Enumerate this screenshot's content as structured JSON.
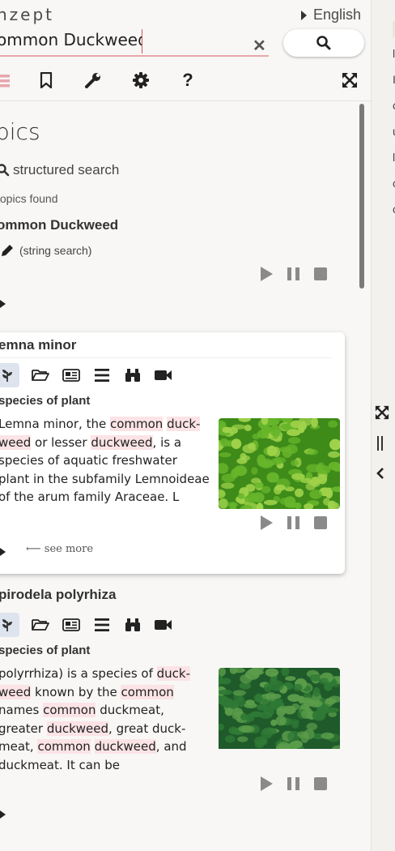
{
  "header": {
    "brand": "nzept",
    "language": "English",
    "search_value": "ommon Duckweed",
    "clear_symbol": "✕"
  },
  "toolbar": {
    "icons": [
      "menu-icon",
      "bookmark-icon",
      "wrench-icon",
      "gear-icon",
      "help-icon",
      "expand-icon"
    ],
    "help_glyph": "?"
  },
  "content": {
    "title": "pics",
    "structured_search": "structured search",
    "found_text": "topics found",
    "query_echo": "ommon Duckweed",
    "string_search": "(string search)"
  },
  "cards": [
    {
      "title": "emna minor",
      "description": "species of plant",
      "see_more": "see more",
      "text_parts": [
        {
          "t": "Lemna minor, the ",
          "h": false
        },
        {
          "t": "common",
          "h": true
        },
        {
          "t": " ",
          "h": false
        },
        {
          "t": "duck-",
          "h": true
        },
        {
          "t": "\n",
          "h": false
        },
        {
          "t": "weed",
          "h": true
        },
        {
          "t": " or lesser ",
          "h": false
        },
        {
          "t": "duckweed",
          "h": true
        },
        {
          "t": ", is a\nspecies of aquatic freshwater\nplant in the subfamily Lemnoideae\nof the arum family Araceae. L",
          "h": false
        }
      ],
      "image_colors": [
        "#3e8b1a",
        "#67b52a",
        "#9fd24a"
      ]
    },
    {
      "title": "pirodela polyrhiza",
      "description": "species of plant",
      "text_parts": [
        {
          "t": "polyrrhiza) is a species of ",
          "h": false
        },
        {
          "t": "duck-",
          "h": true
        },
        {
          "t": "\n",
          "h": false
        },
        {
          "t": "weed",
          "h": true
        },
        {
          "t": " known by the ",
          "h": false
        },
        {
          "t": "common",
          "h": true
        },
        {
          "t": "\nnames ",
          "h": false
        },
        {
          "t": "common",
          "h": true
        },
        {
          "t": " duckmeat,\ngreater ",
          "h": false
        },
        {
          "t": "duckweed",
          "h": true
        },
        {
          "t": ", great duck-\nmeat, ",
          "h": false
        },
        {
          "t": "common",
          "h": true
        },
        {
          "t": " ",
          "h": false
        },
        {
          "t": "duckweed",
          "h": true
        },
        {
          "t": ", and\nduckmeat. It can be",
          "h": false
        }
      ],
      "image_colors": [
        "#1f5a2a",
        "#2f7a35",
        "#5a9c4a"
      ]
    }
  ],
  "right_pane": {
    "letters": [
      "I",
      "l",
      "I",
      "c",
      "u",
      "l",
      "c",
      "c"
    ]
  },
  "colors": {
    "accent_pink": "#e8a6ae",
    "highlight": "#fbe3e6",
    "selected_bg": "#dde4ee"
  }
}
